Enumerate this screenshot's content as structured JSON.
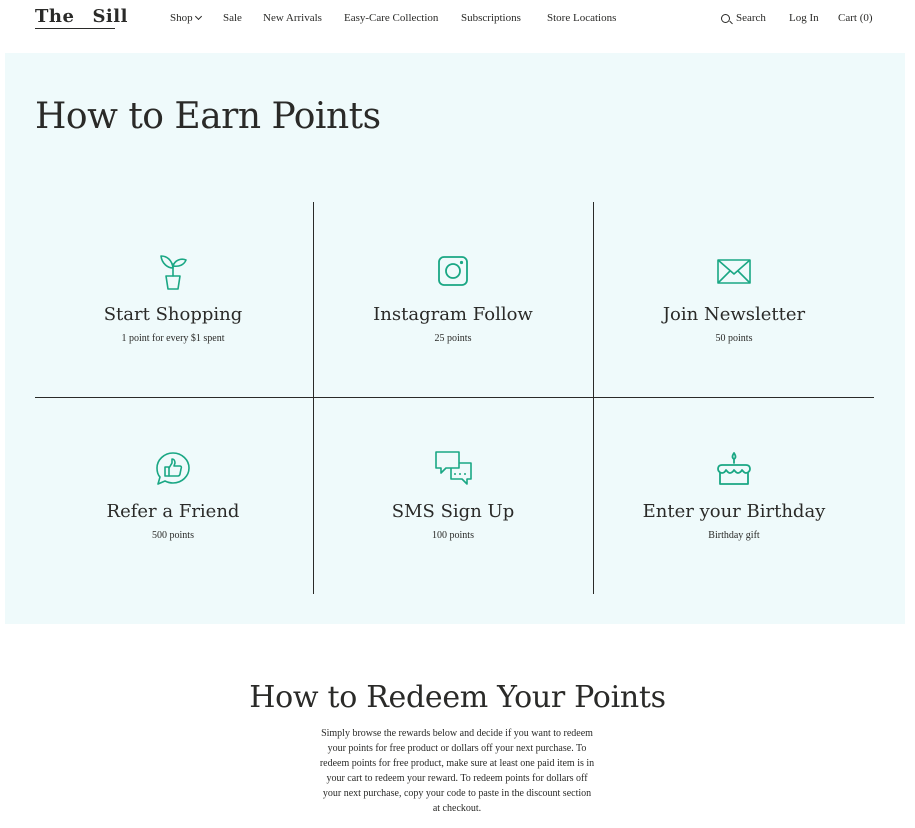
{
  "header": {
    "logo_left": "The",
    "logo_right": "Sill",
    "nav": {
      "shop": "Shop",
      "sale": "Sale",
      "new_arrivals": "New Arrivals",
      "easy_care": "Easy-Care Collection",
      "subscriptions": "Subscriptions",
      "store_locations": "Store Locations"
    },
    "search": "Search",
    "login": "Log In",
    "cart": "Cart (0)"
  },
  "earn": {
    "title": "How to Earn Points",
    "items": [
      {
        "title": "Start Shopping",
        "sub": "1 point for every $1 spent",
        "icon": "plant-pot-icon"
      },
      {
        "title": "Instagram Follow",
        "sub": "25 points",
        "icon": "instagram-icon"
      },
      {
        "title": "Join Newsletter",
        "sub": "50 points",
        "icon": "envelope-icon"
      },
      {
        "title": "Refer a Friend",
        "sub": "500 points",
        "icon": "thumbs-up-chat-icon"
      },
      {
        "title": "SMS Sign Up",
        "sub": "100 points",
        "icon": "chat-bubbles-icon"
      },
      {
        "title": "Enter your Birthday",
        "sub": "Birthday gift",
        "icon": "birthday-cake-icon"
      }
    ]
  },
  "redeem": {
    "title": "How to Redeem Your Points",
    "lines": [
      "Simply browse the rewards below and decide if you want to redeem",
      "your points for free product or dollars off your next purchase. To",
      "redeem points for free product, make sure at least one paid item is in",
      "your cart to redeem your reward. To redeem points for dollars off",
      "your next purchase, copy your code to paste in the discount section",
      "at checkout."
    ]
  },
  "colors": {
    "accent": "#1aa784",
    "section_bg": "#effafb",
    "text": "#2a2a28"
  }
}
